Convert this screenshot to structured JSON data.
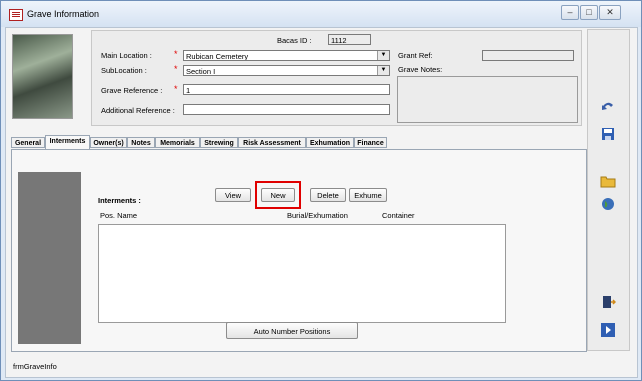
{
  "window": {
    "title": "Grave Information",
    "minimize": "–",
    "maximize": "□",
    "close": "✕"
  },
  "header": {
    "bacas_label": "Bacas ID :",
    "bacas_value": "1112",
    "main_location_label": "Main Location :",
    "main_location_value": "Rubican Cemetery",
    "sublocation_label": "SubLocation :",
    "sublocation_value": "Section I",
    "grave_reference_label": "Grave Reference :",
    "grave_reference_value": "1",
    "additional_reference_label": "Additional Reference :",
    "additional_reference_value": "",
    "grant_ref_label": "Grant Ref:",
    "grant_ref_value": "",
    "grave_notes_label": "Grave Notes:",
    "required_mark": "*",
    "dropdown_arrow": "▼"
  },
  "tabs": [
    "General",
    "Interments",
    "Owner(s)",
    "Notes",
    "Memorials",
    "Strewing",
    "Risk Assessment",
    "Exhumation",
    "Finance"
  ],
  "interments": {
    "label": "Interments :",
    "buttons": {
      "view": "View",
      "new": "New",
      "delete": "Delete",
      "exhume": "Exhume"
    },
    "columns": [
      "Pos. Name",
      "Burial/Exhumation",
      "Container"
    ],
    "auto_number_label": "Auto Number Positions"
  },
  "toolbar_icons": [
    "undo-icon",
    "save-icon",
    "folder-icon",
    "globe-icon",
    "exit-door-icon",
    "next-record-icon"
  ],
  "footer": {
    "form_name": "frmGraveInfo"
  },
  "colors": {
    "highlight": "#e00000",
    "required": "#e00000",
    "panel_grey": "#777777"
  }
}
